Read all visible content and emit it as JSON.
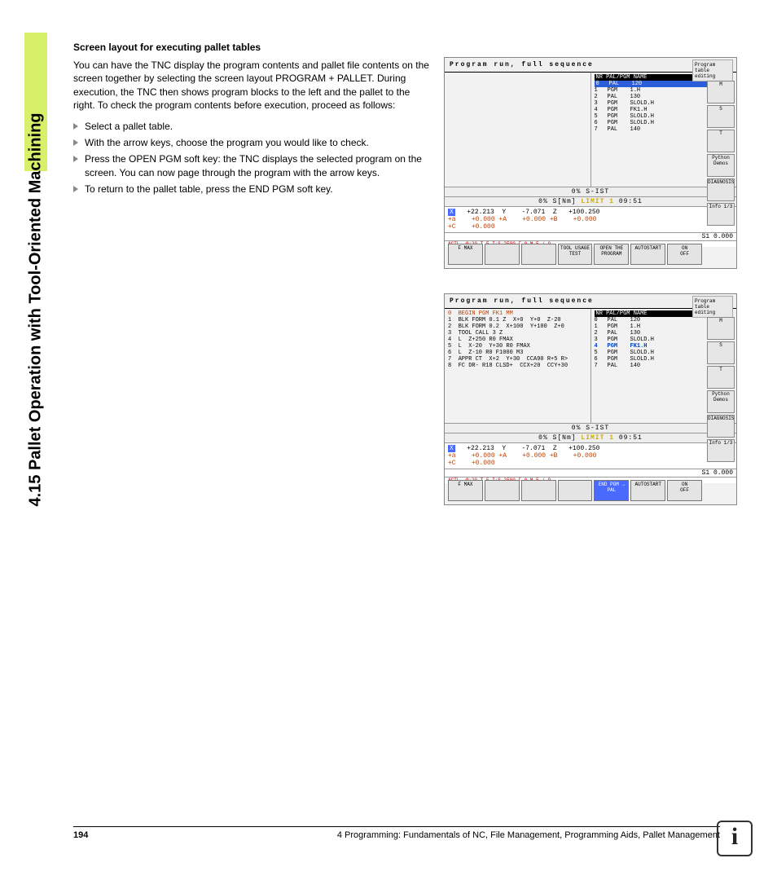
{
  "sidebar": {
    "title": "4.15 Pallet Operation with Tool-Oriented Machining"
  },
  "doc": {
    "heading": "Screen layout for executing pallet tables",
    "para1": "You can have the TNC display the program contents and pallet file contents on the screen together by selecting the screen layout PROGRAM + PALLET. During execution, the TNC then shows program blocks to the left and the pallet to the right. To check the program contents before execution, proceed as follows:",
    "li1": "Select a pallet table.",
    "li2": "With the arrow keys, choose the program you would like to check.",
    "li3": "Press the OPEN PGM soft key: the TNC displays the selected program on the screen. You can now page through the program with the arrow keys.",
    "li4": "To return to the pallet table, press the END PGM soft key."
  },
  "screen1": {
    "title": "Program run, full sequence",
    "mode": "Program table editing",
    "header": "NR  PAL/PGM NAME",
    "hdr_end": ">>",
    "rows": {
      "r0": {
        "n": "0",
        "t": "PAL",
        "v": "120",
        "sel": true
      },
      "r1": {
        "n": "1",
        "t": "PGM",
        "v": "1.H"
      },
      "r2": {
        "n": "2",
        "t": "PAL",
        "v": "130"
      },
      "r3": {
        "n": "3",
        "t": "PGM",
        "v": "SLOLD.H"
      },
      "r4": {
        "n": "4",
        "t": "PGM",
        "v": "FK1.H"
      },
      "r5": {
        "n": "5",
        "t": "PGM",
        "v": "SLOLD.H"
      },
      "r6": {
        "n": "6",
        "t": "PGM",
        "v": "SLOLD.H"
      },
      "r7": {
        "n": "7",
        "t": "PAL",
        "v": "140"
      }
    },
    "status1": "0% S-IST",
    "status2a": "0% S[Nm]",
    "status2b": "LIMIT 1",
    "status2c": "09:51",
    "x": "+22.213",
    "y": "-7.071",
    "z": "+100.250",
    "a": "+0.000",
    "aA": "+0.000",
    "b": "+0.000",
    "c": "+0.000",
    "s": "S1   0.000",
    "actl": "ACTL.",
    "tline": "@:20    T 5     Z:S 2500     F 0      M 5 / 9",
    "sk_fmax": "F MAX",
    "sk_tool": "TOOL USAGE TEST",
    "sk_open": "OPEN THE PROGRAM",
    "sk_auto": "AUTOSTART",
    "sk_on": "ON",
    "sk_off": "OFF",
    "v_m": "M",
    "v_s": "S",
    "v_t": "T",
    "v_py": "Python Demos",
    "v_diag": "DIAGNOSIS",
    "v_info": "Info 1/3"
  },
  "screen2": {
    "title": "Program run, full sequence",
    "mode": "Program table editing",
    "prog": {
      "l0": "0  BEGIN PGM FK1 MM",
      "l1": "1  BLK FORM 0.1 Z  X+0  Y+0  Z-20",
      "l2": "2  BLK FORM 0.2  X+100  Y+100  Z+0",
      "l3": "3  TOOL CALL 3 Z",
      "l4": "4  L  Z+250 R0 FMAX",
      "l5": "5  L  X-20  Y+30 R0 FMAX",
      "l6": "6  L  Z-10 R0 F1000 M3",
      "l7": "7  APPR CT  X+2  Y+30  CCA90 R+5 R>",
      "l8": "8  FC DR- R18 CLSD+  CCX+20  CCY+30"
    },
    "header": "NR  PAL/PGM NAME",
    "hdr_end": ">>",
    "rows": {
      "r0": {
        "n": "0",
        "t": "PAL",
        "v": "120"
      },
      "r1": {
        "n": "1",
        "t": "PGM",
        "v": "1.H"
      },
      "r2": {
        "n": "2",
        "t": "PAL",
        "v": "130"
      },
      "r3": {
        "n": "3",
        "t": "PGM",
        "v": "SLOLD.H"
      },
      "r4": {
        "n": "4",
        "t": "PGM",
        "v": "FK1.H",
        "sel": true
      },
      "r5": {
        "n": "5",
        "t": "PGM",
        "v": "SLOLD.H"
      },
      "r6": {
        "n": "6",
        "t": "PGM",
        "v": "SLOLD.H"
      },
      "r7": {
        "n": "7",
        "t": "PAL",
        "v": "140"
      }
    },
    "status1": "0% S-IST",
    "status2a": "0% S[Nm]",
    "status2b": "LIMIT 1",
    "status2c": "09:51",
    "x": "+22.213",
    "y": "-7.071",
    "z": "+100.250",
    "a": "+0.000",
    "aA": "+0.000",
    "b": "+0.000",
    "c": "+0.000",
    "s": "S1   0.000",
    "actl": "ACTL.",
    "tline": "@:20    T 5     Z:S 2500     F 0      M 5 / 9",
    "sk_fmax": "F MAX",
    "sk_end": "END PGM → PAL",
    "sk_auto": "AUTOSTART",
    "sk_on": "ON",
    "sk_off": "OFF"
  },
  "footer": {
    "page": "194",
    "text": "4 Programming: Fundamentals of NC, File Management, Programming Aids, Pallet Management"
  },
  "info_icon": "i"
}
